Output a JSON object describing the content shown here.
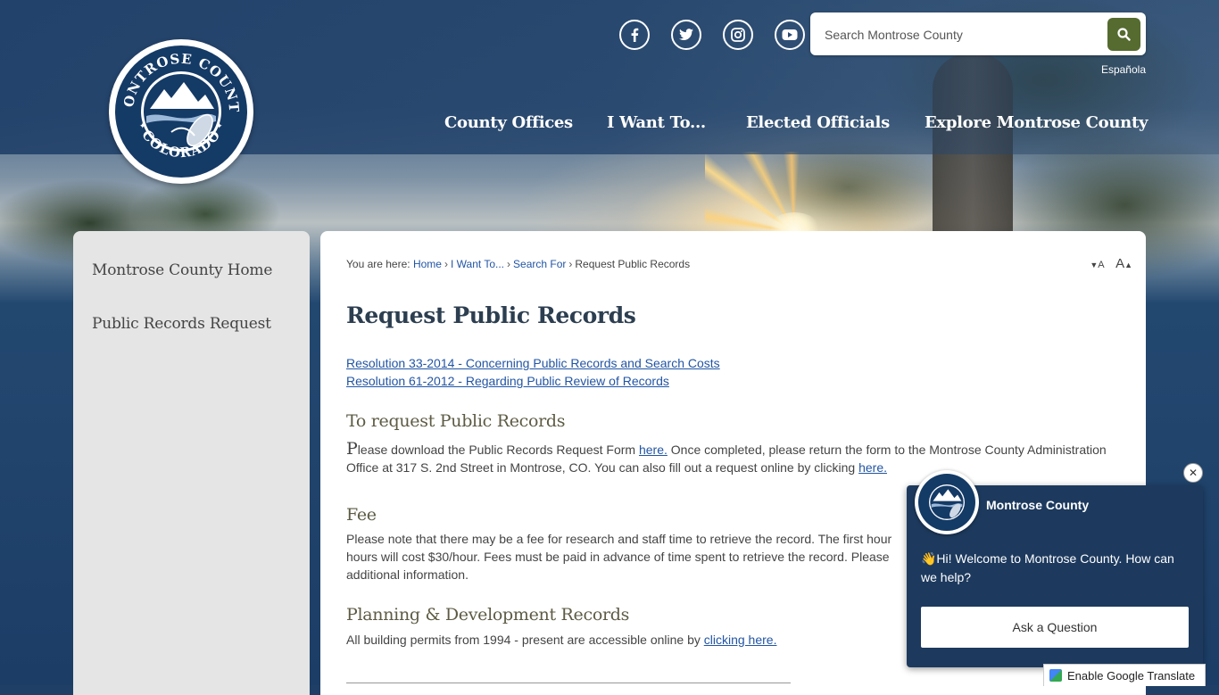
{
  "header": {
    "logo_text_top": "MONTROSE COUNTY",
    "logo_text_bottom": "COLORADO",
    "social": [
      "facebook-icon",
      "twitter-icon",
      "instagram-icon",
      "youtube-icon"
    ],
    "search": {
      "placeholder": "Search Montrose County"
    },
    "language_link": "Española",
    "nav": [
      "County Offices",
      "I Want To...",
      "Elected Officials",
      "Explore Montrose County"
    ]
  },
  "sidebar": {
    "items": [
      "Montrose County Home",
      "Public Records Request"
    ]
  },
  "breadcrumb": {
    "prefix": "You are here:",
    "items": [
      "Home",
      "I Want To...",
      "Search For"
    ],
    "current": "Request Public Records"
  },
  "font_controls": {
    "decrease": "A",
    "increase": "A"
  },
  "main": {
    "title": "Request Public Records",
    "doc_links": [
      "Resolution 33-2014 - Concerning Public Records and Search Costs",
      "Resolution 61-2012 - Regarding Public Review of Records"
    ],
    "sections": {
      "request": {
        "heading": "To request Public Records",
        "dropcap": "P",
        "text_1": "lease download the Public Records Request Form ",
        "link_1": "here.",
        "text_2": " Once completed, please return the form to the Montrose County Administration Office at 317 S. 2nd Street in Montrose, CO. You can also fill out a request online by clicking ",
        "link_2": "here."
      },
      "fee": {
        "heading": "Fee",
        "line_1": "Please note that there may be a fee for research and staff time to retrieve the record. The first hour",
        "line_2": "hours will cost $30/hour. Fees must be paid in advance of time spent to retrieve the record. Please",
        "line_3": "additional information."
      },
      "planning": {
        "heading": "Planning & Development Records",
        "text": "All building permits from 1994 - present are accessible online by ",
        "link": "clicking here."
      }
    }
  },
  "chat": {
    "org_name": "Montrose County",
    "message": "👋Hi! Welcome to Montrose County. How can we help?",
    "button": "Ask a Question",
    "close": "✕"
  },
  "translate": {
    "label": "Enable Google Translate"
  },
  "colors": {
    "header_blue": "#1e3e68",
    "search_button": "#556b2f",
    "link": "#2255a4",
    "heading_olive": "#5d5b44",
    "chat_bg": "#1d3a5e"
  }
}
